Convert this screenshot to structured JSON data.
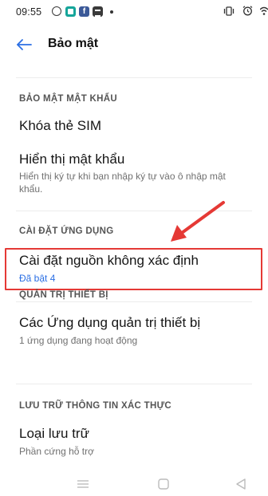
{
  "status_bar": {
    "time": "09:55",
    "icons": [
      "circle-notification-icon",
      "app-notification-icon",
      "facebook-icon",
      "message-icon",
      "dot-icon",
      "vibrate-icon",
      "alarm-icon",
      "wifi-icon"
    ]
  },
  "header": {
    "title": "Bảo mật",
    "back_icon": "arrow-left-icon"
  },
  "sections": [
    {
      "header": "BẢO MẬT MẬT KHẨU",
      "items": [
        {
          "title": "Khóa thẻ SIM",
          "subtitle": ""
        },
        {
          "title": "Hiển thị mật khẩu",
          "subtitle": "Hiển thị ký tự khi bạn nhập ký tự vào ô nhập mật khẩu."
        }
      ]
    },
    {
      "header": "CÀI ĐẶT ỨNG DỤNG",
      "items": [
        {
          "title": "Cài đặt nguồn không xác định",
          "subtitle": "Đã bật 4"
        }
      ]
    },
    {
      "header": "QUẢN TRỊ THIẾT BỊ",
      "items": [
        {
          "title": "Các Ứng dụng quản trị thiết bị",
          "subtitle": "1 ứng dụng đang hoạt động"
        }
      ]
    },
    {
      "header": "LƯU TRỮ THÔNG TIN XÁC THỰC",
      "items": [
        {
          "title": "Loại lưu trữ",
          "subtitle": "Phần cứng hỗ trợ"
        }
      ]
    }
  ],
  "annotation": {
    "arrow_color": "#e53935",
    "box_color": "#e53935"
  },
  "colors": {
    "accent": "#2b6fe4",
    "highlight": "#e53935"
  },
  "nav_bar": {
    "icons": [
      "menu-icon",
      "home-icon",
      "back-triangle-icon"
    ]
  }
}
